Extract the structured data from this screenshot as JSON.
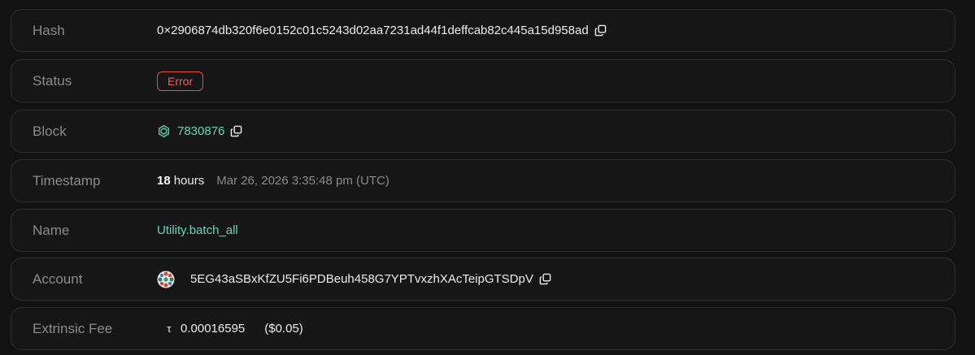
{
  "hash": {
    "label": "Hash",
    "value": "0×2906874db320f6e0152c01c5243d02aa7231ad44f1deffcab82c445a15d958ad"
  },
  "status": {
    "label": "Status",
    "value": "Error",
    "color": "#e0534f"
  },
  "block": {
    "label": "Block",
    "value": "7830876",
    "icon": "block-hexagon-icon"
  },
  "timestamp": {
    "label": "Timestamp",
    "relative_number": "18",
    "relative_unit": "hours",
    "date": "Mar 26, 2026 3:35:48 pm (UTC)"
  },
  "name": {
    "label": "Name",
    "value": "Utility.batch_all"
  },
  "account": {
    "label": "Account",
    "value": "5EG43aSBxKfZU5Fi6PDBeuh458G7YPTvxzhXAcTeipGTSDpV",
    "icon": "account-avatar-icon"
  },
  "fee": {
    "label": "Extrinsic Fee",
    "symbol": "τ",
    "amount": "0.00016595",
    "usd": "($0.05)"
  },
  "colors": {
    "background": "#121212",
    "row_border": "#2f2f2f",
    "label": "#8b8b8b",
    "accent_green": "#62d6b4",
    "error_red": "#e0534f"
  }
}
